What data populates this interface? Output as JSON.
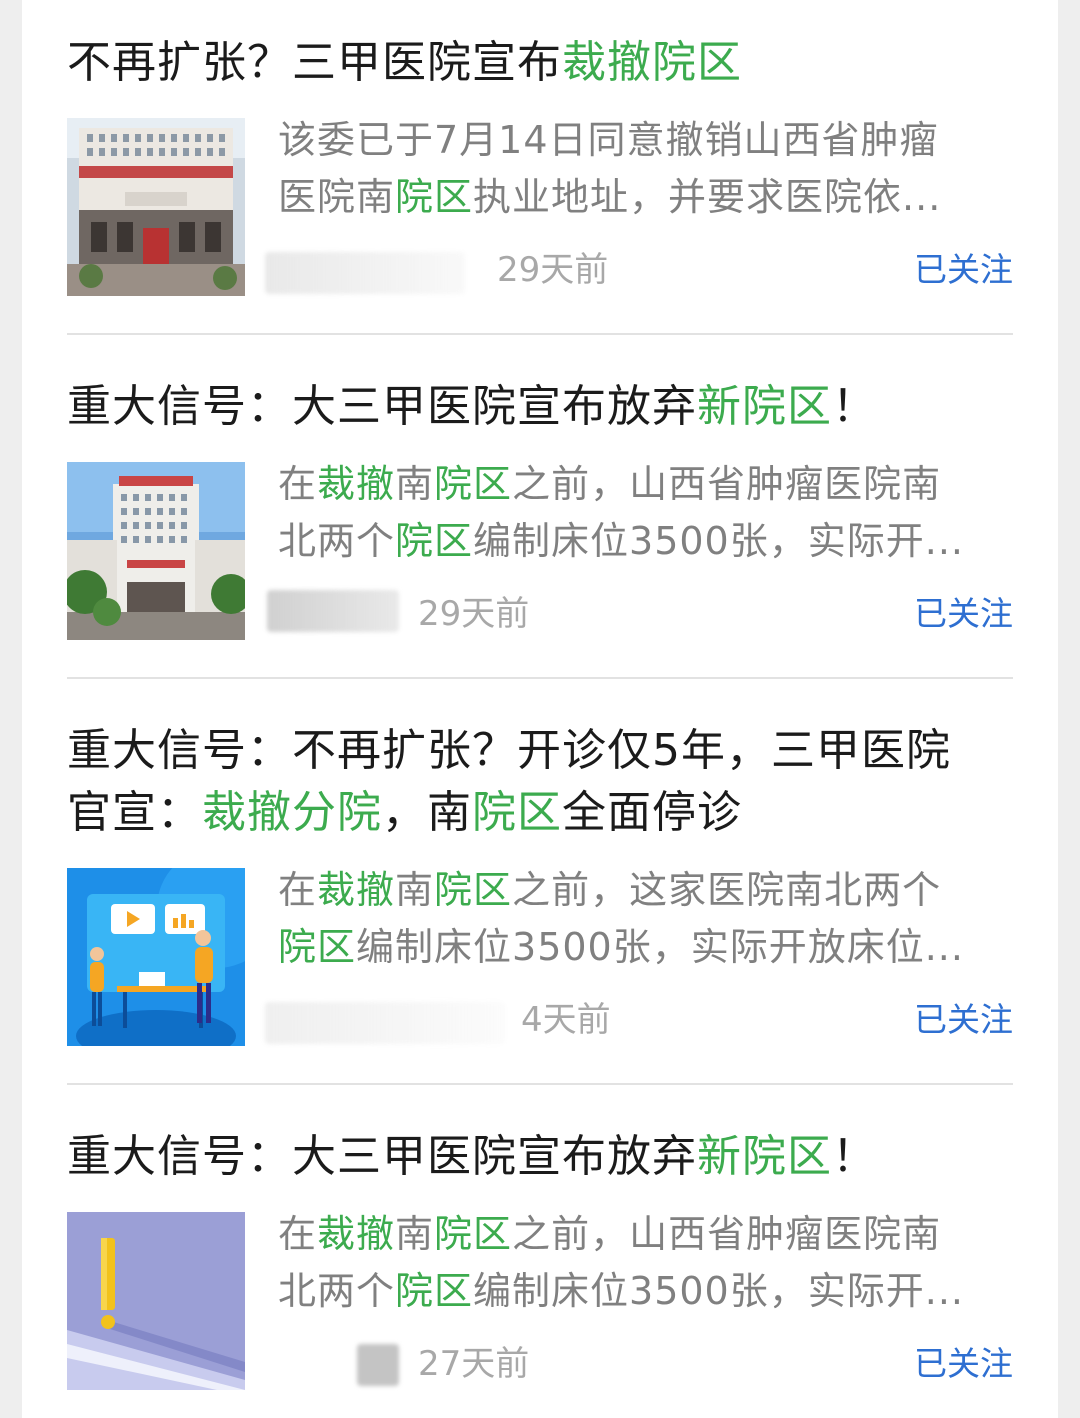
{
  "colors": {
    "title_text": "#1b1b1b",
    "keyword_highlight": "#3cab4e",
    "summary_text": "#808080",
    "time_text": "#a8a8a8",
    "follow_link": "#2e6fd1",
    "divider": "#e2e2e2"
  },
  "articles": [
    {
      "title_segments": [
        {
          "text": "不再扩张？三甲医院宣布"
        },
        {
          "text": "裁撤院区"
        }
      ],
      "summary_line1": [
        {
          "text": "该委已于7月14日同意撤销山西省肿瘤"
        }
      ],
      "summary_line2": [
        {
          "text": "医院南"
        },
        {
          "text": "院区"
        },
        {
          "text": "执业地址，并要求医院依..."
        }
      ],
      "time": "29天前",
      "follow_label": "已关注",
      "thumbnail_icon": "hospital-building-image"
    },
    {
      "title_segments": [
        {
          "text": "重大信号：大三甲医院宣布放弃"
        },
        {
          "text": "新院区"
        },
        {
          "text": "！"
        }
      ],
      "summary_line1": [
        {
          "text": "在"
        },
        {
          "text": "裁撤"
        },
        {
          "text": "南"
        },
        {
          "text": "院区"
        },
        {
          "text": "之前，山西省肿瘤医院南"
        }
      ],
      "summary_line2": [
        {
          "text": "北两个"
        },
        {
          "text": "院区"
        },
        {
          "text": "编制床位3500张，实际开..."
        }
      ],
      "time": "29天前",
      "follow_label": "已关注",
      "thumbnail_icon": "hospital-building-image"
    },
    {
      "title_line1": "重大信号：不再扩张？开诊仅5年，三甲医院",
      "title_line2_segments": [
        {
          "text": "官宣："
        },
        {
          "text": "裁撤分院"
        },
        {
          "text": "，南"
        },
        {
          "text": "院区"
        },
        {
          "text": "全面停诊"
        }
      ],
      "summary_line1": [
        {
          "text": "在"
        },
        {
          "text": "裁撤"
        },
        {
          "text": "南"
        },
        {
          "text": "院区"
        },
        {
          "text": "之前，这家医院南北两个"
        }
      ],
      "summary_line2": [
        {
          "text": "院区"
        },
        {
          "text": "编制床位3500张，实际开放床位..."
        }
      ],
      "time": "4天前",
      "follow_label": "已关注",
      "thumbnail_icon": "presentation-illustration-image"
    },
    {
      "title_segments": [
        {
          "text": "重大信号：大三甲医院宣布放弃"
        },
        {
          "text": "新院区"
        },
        {
          "text": "！"
        }
      ],
      "summary_line1": [
        {
          "text": "在"
        },
        {
          "text": "裁撤"
        },
        {
          "text": "南"
        },
        {
          "text": "院区"
        },
        {
          "text": "之前，山西省肿瘤医院南"
        }
      ],
      "summary_line2": [
        {
          "text": "北两个"
        },
        {
          "text": "院区"
        },
        {
          "text": "编制床位3500张，实际开..."
        }
      ],
      "time": "27天前",
      "follow_label": "已关注",
      "thumbnail_icon": "exclamation-mark-image"
    }
  ]
}
